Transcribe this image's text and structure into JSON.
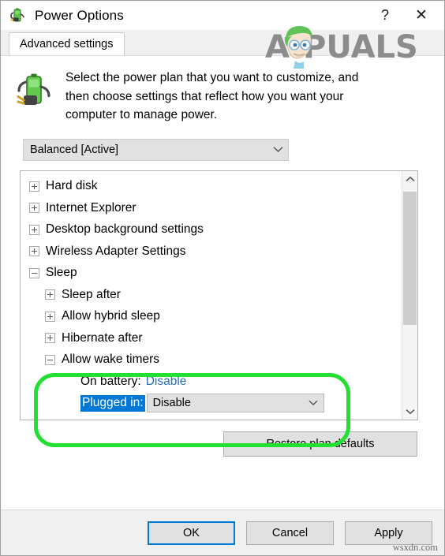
{
  "window": {
    "title": "Power Options",
    "icon": "power-plug-battery-icon",
    "help_label": "?",
    "close_label": "✕"
  },
  "tabs": [
    {
      "label": "Advanced settings",
      "active": true
    }
  ],
  "intro": {
    "text": "Select the power plan that you want to customize, and then choose settings that reflect how you want your computer to manage power.",
    "icon": "battery-plug-icon"
  },
  "plan_combo": {
    "name": "power-plan-select",
    "value": "Balanced [Active]",
    "chevron": "chevron-down-icon"
  },
  "tree": {
    "nodes": [
      {
        "label": "Hard disk",
        "level": 0,
        "state": "collapsed"
      },
      {
        "label": "Internet Explorer",
        "level": 0,
        "state": "collapsed"
      },
      {
        "label": "Desktop background settings",
        "level": 0,
        "state": "collapsed"
      },
      {
        "label": "Wireless Adapter Settings",
        "level": 0,
        "state": "collapsed"
      },
      {
        "label": "Sleep",
        "level": 0,
        "state": "expanded"
      },
      {
        "label": "Sleep after",
        "level": 1,
        "state": "collapsed"
      },
      {
        "label": "Allow hybrid sleep",
        "level": 1,
        "state": "collapsed"
      },
      {
        "label": "Hibernate after",
        "level": 1,
        "state": "collapsed"
      },
      {
        "label": "Allow wake timers",
        "level": 1,
        "state": "expanded"
      }
    ],
    "settings": [
      {
        "label": "On battery:",
        "value": "Disable",
        "type": "link",
        "selected": false
      },
      {
        "label": "Plugged in:",
        "value": "Disable",
        "type": "combo",
        "selected": true
      }
    ]
  },
  "scrollbar": {
    "up_icon": "chevron-up-icon",
    "down_icon": "chevron-down-icon"
  },
  "buttons": {
    "restore": "Restore plan defaults",
    "ok": "OK",
    "cancel": "Cancel",
    "apply": "Apply"
  },
  "annotation": {
    "type": "green-rounded-highlight",
    "color": "#22e032",
    "targets": "Allow wake timers settings"
  },
  "watermarks": {
    "brand": "PPUALS",
    "brand_full": "APPUALS",
    "site": "wsxdn.com"
  },
  "colors": {
    "selection_blue": "#0078d7",
    "link_blue": "#2a6fb5",
    "highlight_green": "#22e032",
    "control_gray": "#e1e1e1"
  }
}
